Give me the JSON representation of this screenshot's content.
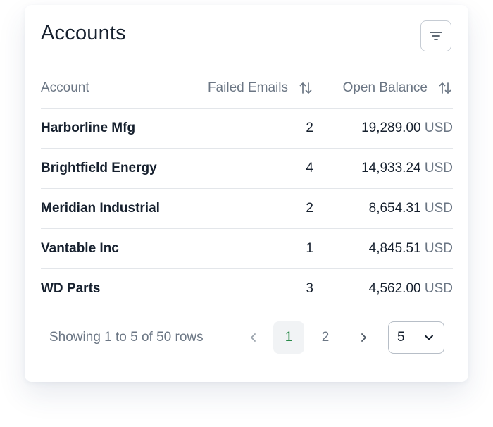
{
  "card": {
    "title": "Accounts",
    "filter_icon": "filter-lines-icon"
  },
  "table": {
    "columns": [
      {
        "label": "Account",
        "sortable": false
      },
      {
        "label": "Failed Emails",
        "sortable": true,
        "icon": "sort-arrows-icon"
      },
      {
        "label": "Open Balance",
        "sortable": true,
        "icon": "sort-arrows-icon"
      }
    ],
    "rows": [
      {
        "account": "Harborline Mfg",
        "failed_emails": "2",
        "balance": "19,289.00",
        "currency": "USD"
      },
      {
        "account": "Brightfield Energy",
        "failed_emails": "4",
        "balance": "14,933.24",
        "currency": "USD"
      },
      {
        "account": "Meridian Industrial",
        "failed_emails": "2",
        "balance": "8,654.31",
        "currency": "USD"
      },
      {
        "account": "Vantable Inc",
        "failed_emails": "1",
        "balance": "4,845.51",
        "currency": "USD"
      },
      {
        "account": "WD Parts",
        "failed_emails": "3",
        "balance": "4,562.00",
        "currency": "USD"
      }
    ]
  },
  "pagination": {
    "summary": "Showing 1 to 5 of 50 rows",
    "pages": [
      "1",
      "2"
    ],
    "current_page": "1",
    "page_size": "5",
    "prev_icon": "chevron-left-icon",
    "next_icon": "chevron-right-icon",
    "dropdown_icon": "chevron-down-icon"
  },
  "colors": {
    "text": "#16202e",
    "muted": "#6b7684",
    "border": "#e3e6ea",
    "active_page_text": "#2a8a4a",
    "active_page_bg": "#f1f3f5"
  }
}
